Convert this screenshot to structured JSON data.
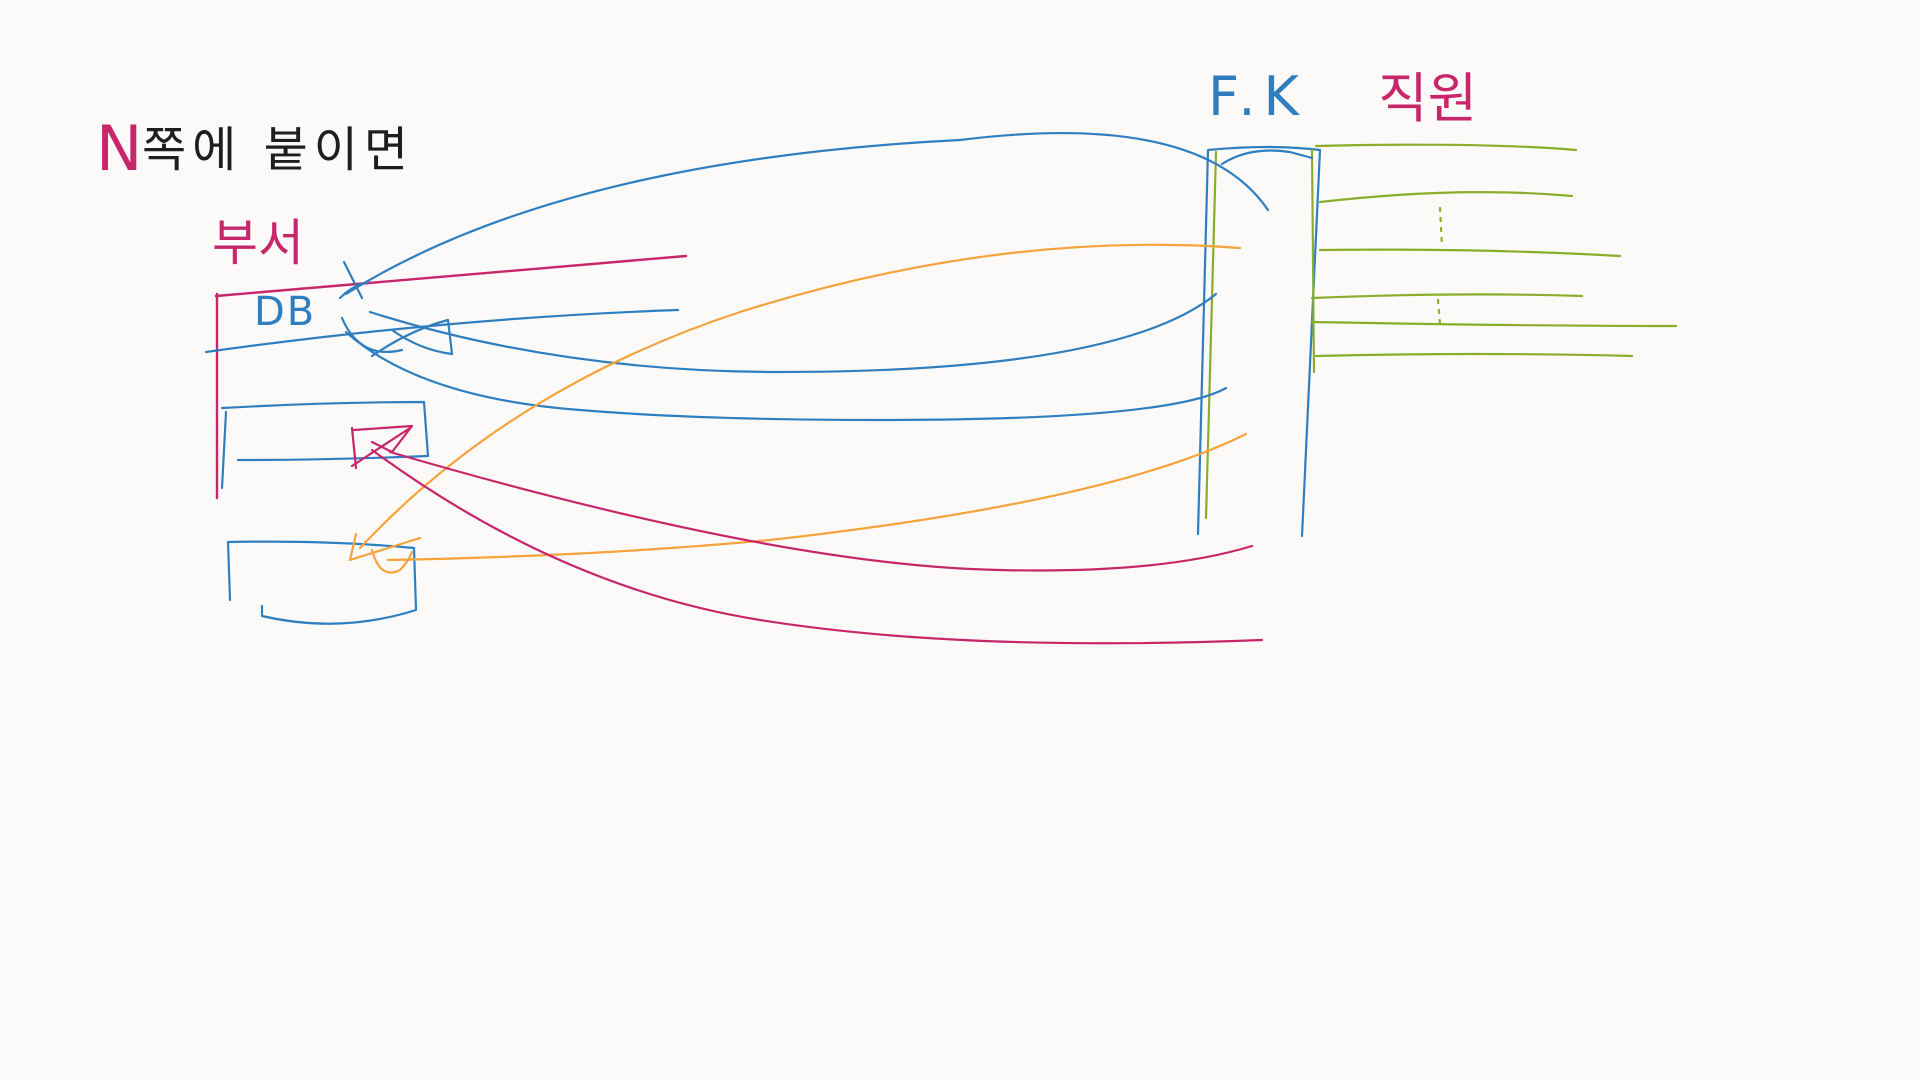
{
  "colors": {
    "background": "#fbfaf8",
    "ink_black": "#1e1e1e",
    "ink_magenta": "#c8266b",
    "ink_blue": "#2f7fc0",
    "ink_orange": "#f5a33a",
    "ink_green": "#8aae2c"
  },
  "notes": {
    "title_n": "N",
    "title_rest": "쪽에 붙이면",
    "dept_label": "부서",
    "db_label": "DB",
    "fk_label": "F.K",
    "emp_label": "직원"
  }
}
